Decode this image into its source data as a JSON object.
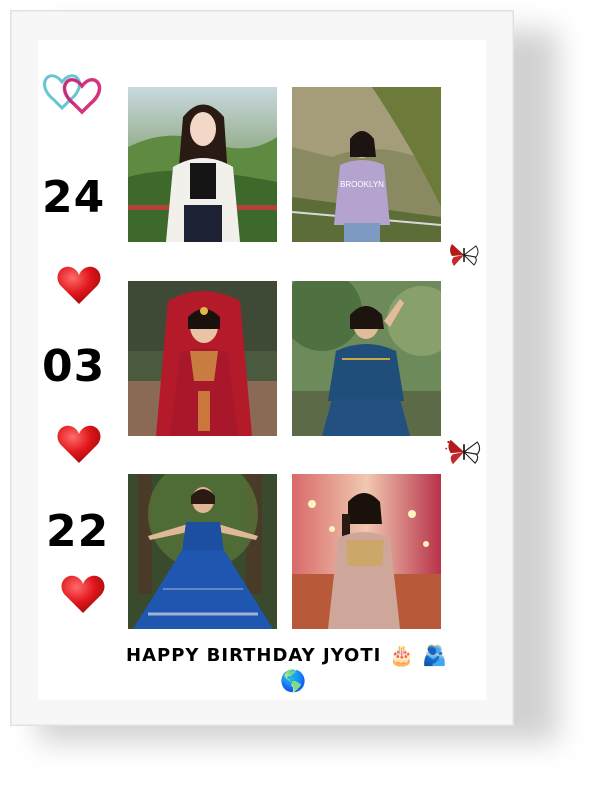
{
  "date": {
    "day": "24",
    "month": "03",
    "year": "22"
  },
  "greeting": {
    "text": "HAPPY BIRTHDAY JYOTI",
    "emoji_cake": "🎂",
    "emoji_people": "🫂",
    "emoji_globe": "🌎"
  },
  "photos": [
    {
      "name": "photo-1",
      "subject": "woman in white cardigan on balcony, green hills"
    },
    {
      "name": "photo-2",
      "subject": "woman in lavender Brooklyn sweatshirt on hillside"
    },
    {
      "name": "photo-3",
      "subject": "bride in red lehenga with jewelry"
    },
    {
      "name": "photo-4",
      "subject": "woman in blue embroidered lehenga, trees"
    },
    {
      "name": "photo-5",
      "subject": "woman twirling in blue lehenga in forest"
    },
    {
      "name": "photo-6",
      "subject": "woman in beige lehenga with festive lights"
    }
  ],
  "colors": {
    "heart_red": "#e0161b",
    "logo_pink": "#d6337e",
    "logo_teal": "#3fb6c9"
  }
}
